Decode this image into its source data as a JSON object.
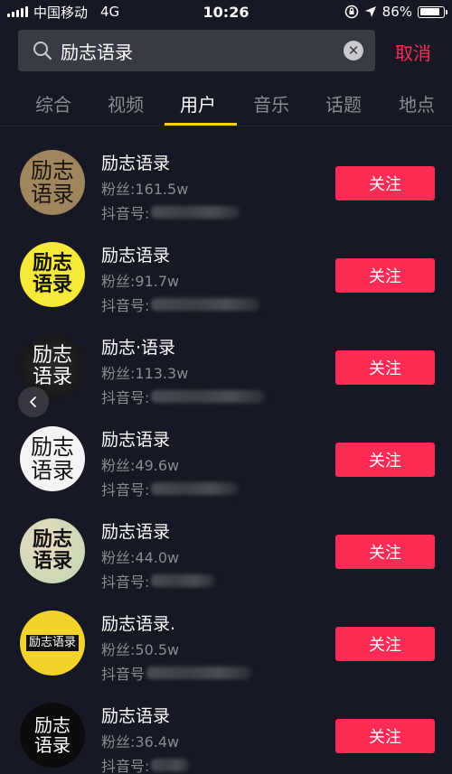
{
  "status_bar": {
    "carrier": "中国移动",
    "network": "4G",
    "time": "10:26",
    "battery": "86%",
    "battery_level": 0.86
  },
  "search": {
    "query": "励志语录",
    "cancel_label": "取消"
  },
  "tabs": [
    {
      "label": "综合"
    },
    {
      "label": "视频"
    },
    {
      "label": "用户"
    },
    {
      "label": "音乐"
    },
    {
      "label": "话题"
    },
    {
      "label": "地点"
    }
  ],
  "active_tab": "用户",
  "users": [
    {
      "name": "励志语录",
      "fans": "粉丝:161.5w",
      "id_prefix": "抖音号:",
      "avatar_line1": "励志",
      "avatar_line2": "语录",
      "follow_label": "关注"
    },
    {
      "name": "励志语录",
      "fans": "粉丝:91.7w",
      "id_prefix": "抖音号:",
      "avatar_line1": "励志",
      "avatar_line2": "语录",
      "follow_label": "关注"
    },
    {
      "name": "励志·语录",
      "fans": "粉丝:113.3w",
      "id_prefix": "抖音号:",
      "avatar_line1": "励志",
      "avatar_line2": "语录",
      "follow_label": "关注"
    },
    {
      "name": "励志语录",
      "fans": "粉丝:49.6w",
      "id_prefix": "抖音号:",
      "avatar_line1": "励志",
      "avatar_line2": "语录",
      "follow_label": "关注"
    },
    {
      "name": "励志语录",
      "fans": "粉丝:44.0w",
      "id_prefix": "抖音号:",
      "avatar_line1": "励志",
      "avatar_line2": "语录",
      "follow_label": "关注"
    },
    {
      "name": "励志语录.",
      "fans": "粉丝:50.5w",
      "id_prefix": "抖音号",
      "avatar_line1": "励志语录",
      "avatar_line2": "",
      "follow_label": "关注"
    },
    {
      "name": "励志语录",
      "fans": "粉丝:36.4w",
      "id_prefix": "抖音号:",
      "avatar_line1": "励志",
      "avatar_line2": "语录",
      "follow_label": "关注"
    }
  ],
  "colors": {
    "background": "#161823",
    "accent": "#fe2c55",
    "tab_indicator": "#face15",
    "secondary_text": "#8a8b91"
  }
}
